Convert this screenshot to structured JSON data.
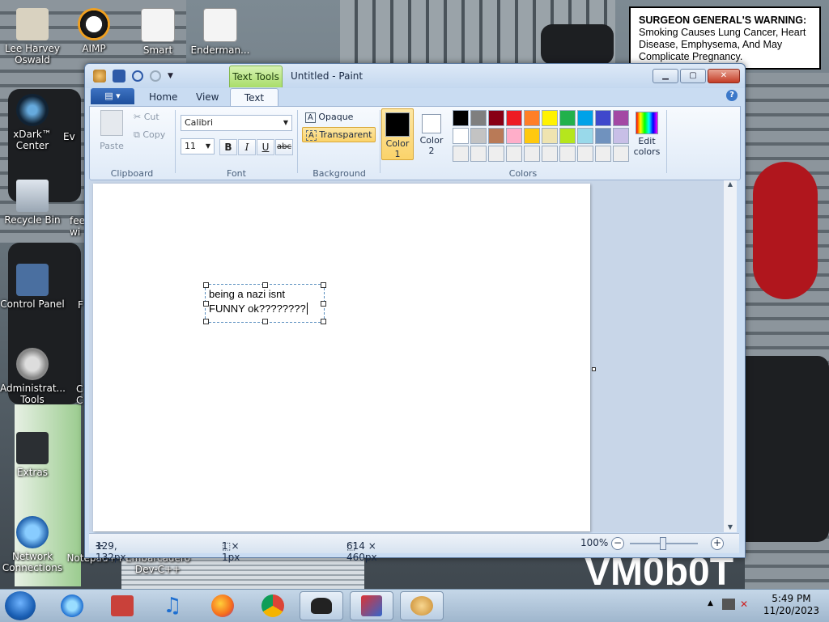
{
  "desktop": {
    "icons": [
      {
        "label": "Lee Harvey Oswald"
      },
      {
        "label": "AIMP"
      },
      {
        "label": "Smart"
      },
      {
        "label": "Enderman..."
      },
      {
        "label": "xDark™ Center"
      },
      {
        "label": "Ev"
      },
      {
        "label": "Recycle Bin"
      },
      {
        "label": "fee wi"
      },
      {
        "label": "Control Panel"
      },
      {
        "label": "F"
      },
      {
        "label": "Administrat... Tools"
      },
      {
        "label": "C C"
      },
      {
        "label": "Extras"
      },
      {
        "label": "Network Connections"
      },
      {
        "label": "Notepad++"
      },
      {
        "label": "Embarcadero Dev-C++"
      }
    ],
    "warning": {
      "bold": "SURGEON GENERAL'S WARNING:",
      "text": " Smoking Causes Lung Cancer, Heart Disease, Emphysema, And May Complicate Pregnancy."
    },
    "bg_text": "VM0b0T"
  },
  "window": {
    "title": "Untitled - Paint",
    "context_tab": "Text Tools",
    "tabs": {
      "home": "Home",
      "view": "View",
      "text": "Text"
    },
    "help_label": "?",
    "buttons": {
      "minimize": "▁",
      "maximize": "▢",
      "close": "✕"
    }
  },
  "ribbon": {
    "clipboard": {
      "label": "Clipboard",
      "paste": "Paste",
      "cut": "Cut",
      "copy": "Copy"
    },
    "font": {
      "label": "Font",
      "family": "Calibri",
      "size": "11",
      "bold": "B",
      "italic": "I",
      "underline": "U",
      "strike": "abc"
    },
    "background": {
      "label": "Background",
      "opaque": "Opaque",
      "transparent": "Transparent"
    },
    "colors": {
      "label": "Colors",
      "color1": "Color 1",
      "color2": "Color 2",
      "edit": "Edit colors",
      "color1_value": "#000000",
      "color2_value": "#ffffff",
      "palette": [
        "#000000",
        "#7f7f7f",
        "#880015",
        "#ed1c24",
        "#ff7f27",
        "#fff200",
        "#22b14c",
        "#00a2e8",
        "#3f48cc",
        "#a349a4",
        "#ffffff",
        "#c3c3c3",
        "#b97a57",
        "#ffaec9",
        "#ffc90e",
        "#efe4b0",
        "#b5e61d",
        "#99d9ea",
        "#7092be",
        "#c8bfe7",
        "#eeeeee",
        "#eeeeee",
        "#eeeeee",
        "#eeeeee",
        "#eeeeee",
        "#eeeeee",
        "#eeeeee",
        "#eeeeee",
        "#eeeeee",
        "#eeeeee"
      ]
    }
  },
  "canvas": {
    "text_line1": "being a nazi isnt",
    "text_line2": "FUNNY ok????????"
  },
  "status": {
    "cursor_pos": "129, 132px",
    "selection_size": "1 × 1px",
    "image_size": "614 × 460px",
    "zoom": "100%"
  },
  "taskbar": {
    "time": "5:49 PM",
    "date": "11/20/2023"
  }
}
